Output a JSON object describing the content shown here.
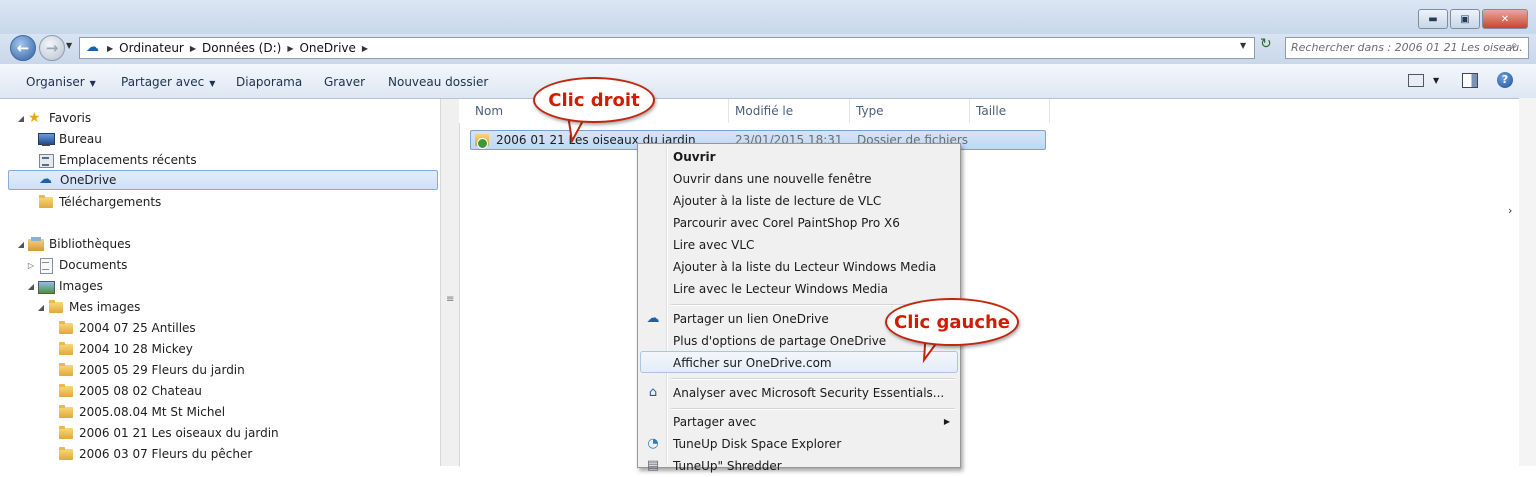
{
  "window": {
    "minimize": "▬",
    "maximize": "▣",
    "close": "✕"
  },
  "address": {
    "crumbs": [
      "Ordinateur",
      "Données (D:)",
      "OneDrive"
    ],
    "search_placeholder": "Rechercher dans : 2006 01 21 Les oiseau..."
  },
  "toolbar": {
    "organiser": "Organiser",
    "partager": "Partager avec",
    "diaporama": "Diaporama",
    "graver": "Graver",
    "nouveau_dossier": "Nouveau dossier"
  },
  "nav": {
    "favoris": "Favoris",
    "bureau": "Bureau",
    "emplacements": "Emplacements récents",
    "onedrive": "OneDrive",
    "telechargements": "Téléchargements",
    "bibliotheques": "Bibliothèques",
    "documents": "Documents",
    "images": "Images",
    "mes_images": "Mes images",
    "folders": [
      "2004 07 25 Antilles",
      "2004 10 28 Mickey",
      "2005 05 29 Fleurs du jardin",
      "2005 08 02 Chateau",
      "2005.08.04 Mt St Michel",
      "2006 01 21 Les oiseaux du jardin",
      "2006 03  07 Fleurs du pêcher"
    ]
  },
  "columns": {
    "nom": "Nom",
    "modifie": "Modifié le",
    "type": "Type",
    "taille": "Taille"
  },
  "file_row": {
    "name": "2006 01 21 Les oiseaux du jardin",
    "date": "23/01/2015 18:31",
    "type": "Dossier de fichiers"
  },
  "context_menu": {
    "ouvrir": "Ouvrir",
    "nouvelle_fenetre": "Ouvrir dans une nouvelle fenêtre",
    "vlc_liste": "Ajouter à la liste de lecture de VLC",
    "corel": "Parcourir avec Corel PaintShop Pro X6",
    "lire_vlc": "Lire avec VLC",
    "wmp_liste": "Ajouter à la liste du Lecteur Windows Media",
    "lire_wmp": "Lire avec le Lecteur Windows Media",
    "partager_lien": "Partager un lien OneDrive",
    "plus_options": "Plus d'options de partage OneDrive",
    "afficher": "Afficher sur OneDrive.com",
    "analyser": "Analyser avec Microsoft Security Essentials...",
    "partager_avec": "Partager avec",
    "tuneup": "TuneUp Disk Space Explorer",
    "shredder": "TuneUp\" Shredder"
  },
  "callouts": {
    "clic_droit": "Clic droit",
    "clic_gauche": "Clic gauche"
  },
  "colors": {
    "callout": "#d11c00",
    "selection": "#cfe0f6"
  }
}
